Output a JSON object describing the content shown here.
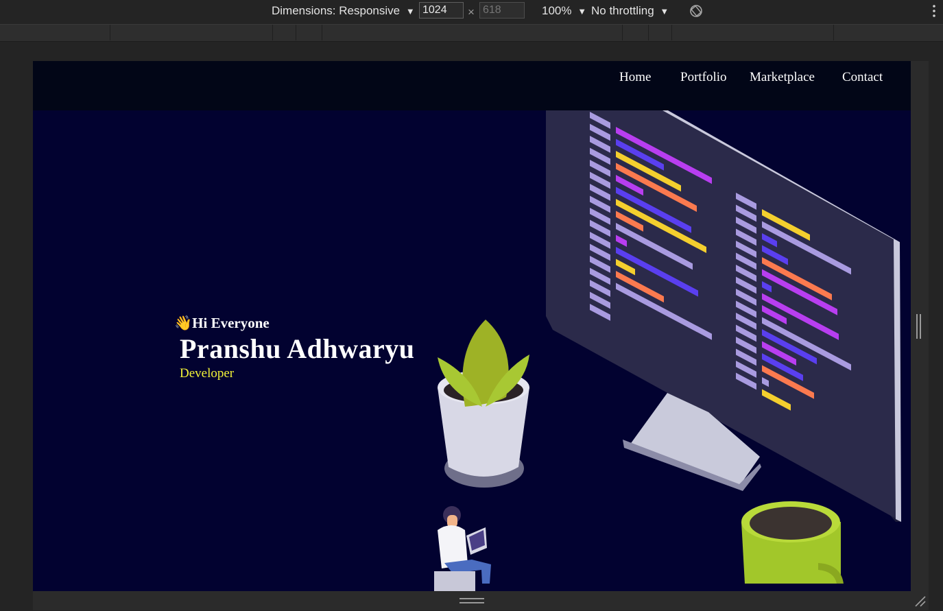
{
  "devtools": {
    "dimensions_label": "Dimensions: Responsive",
    "width_value": "1024",
    "times": "×",
    "height_placeholder": "618",
    "zoom": "100%",
    "throttling": "No throttling",
    "dropdown_arrow": "▼",
    "rotate_icon": "rotate-icon",
    "more_icon": "more-vertical-icon"
  },
  "nav": {
    "items": [
      {
        "label": "Home"
      },
      {
        "label": "Portfolio"
      },
      {
        "label": "Marketplace"
      },
      {
        "label": "Contact"
      }
    ]
  },
  "hero": {
    "wave_emoji": "👋",
    "greeting": "Hi Everyone",
    "name": "Pranshu Adhwaryu",
    "role": "Developer"
  },
  "colors": {
    "page_bg": "#020230",
    "nav_bg": "#020617",
    "role_color": "#f2f238",
    "devtools_bg": "#242424"
  }
}
